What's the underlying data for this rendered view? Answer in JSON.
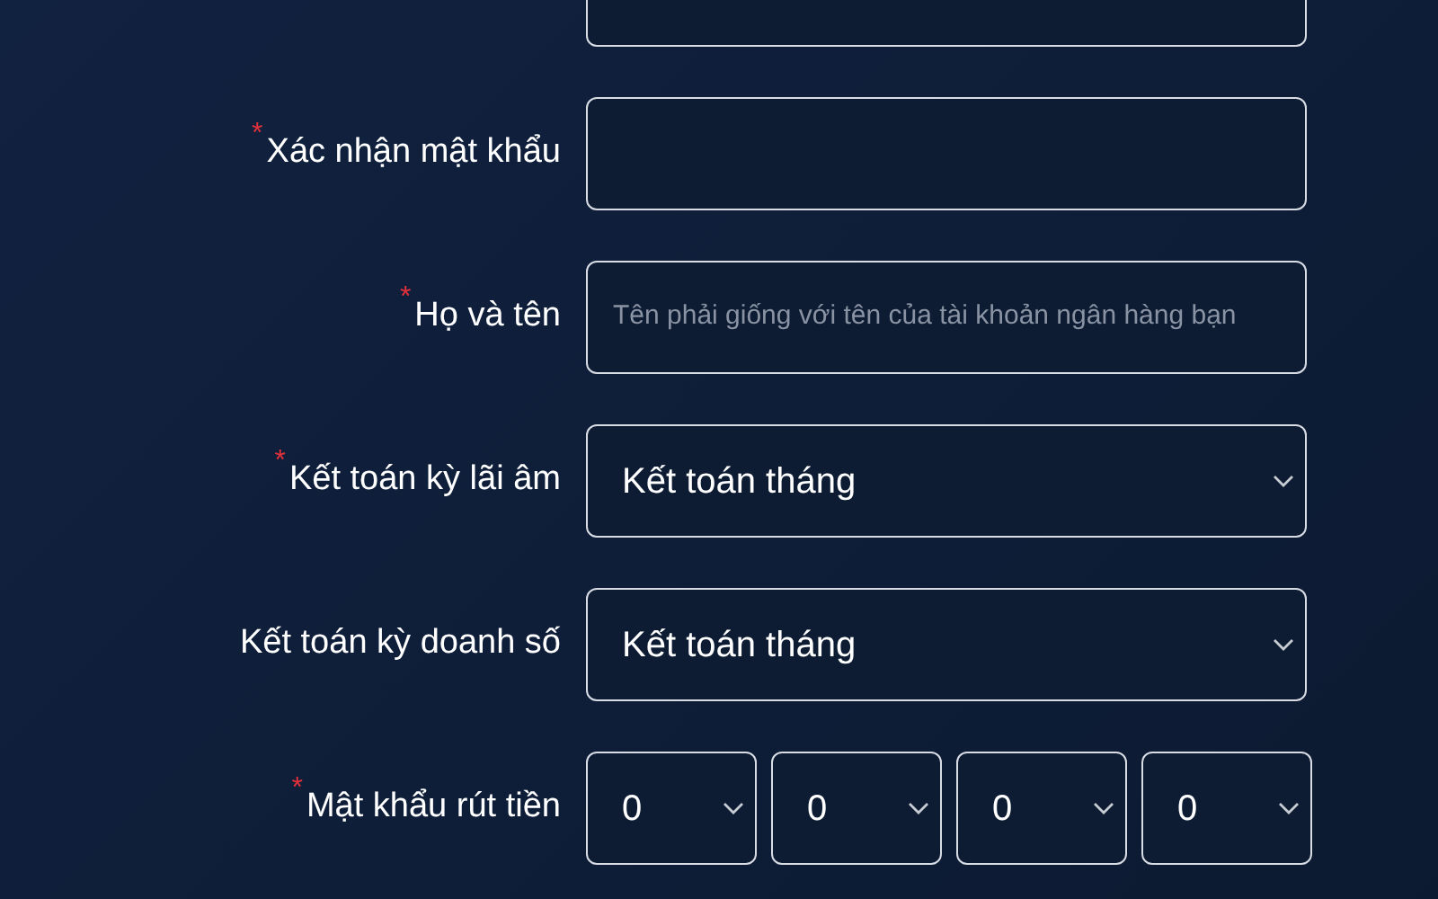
{
  "form": {
    "fields": [
      {
        "kind": "input"
      },
      {
        "kind": "input",
        "label": "Xác nhận mật khẩu",
        "required_mark": "*"
      },
      {
        "kind": "input",
        "label": "Họ và tên",
        "required_mark": "*",
        "placeholder": "Tên phải giống với tên của tài khoản ngân hàng bạn"
      },
      {
        "kind": "select",
        "label": "Kết toán kỳ lãi âm",
        "required_mark": "*",
        "value": "Kết toán tháng"
      },
      {
        "kind": "select",
        "label": "Kết toán kỳ doanh số",
        "value": "Kết toán tháng"
      },
      {
        "kind": "pin",
        "label": "Mật khẩu rút tiền",
        "required_mark": "*",
        "digits": [
          "0",
          "0",
          "0",
          "0"
        ]
      }
    ]
  }
}
